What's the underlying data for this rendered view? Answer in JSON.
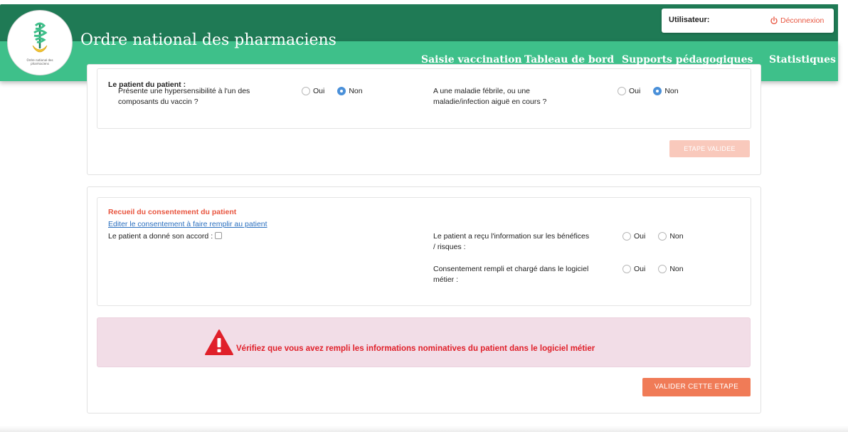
{
  "header": {
    "app_title": "Ordre national des pharmaciens",
    "logo_caption": "Ordre national des pharmaciens",
    "user_label": "Utilisateur:",
    "logout_label": "Déconnexion",
    "nav": [
      "Saisie vaccination",
      "Tableau de bord",
      "Supports pédagogiques",
      "Statistiques"
    ],
    "colors": {
      "dark": "#1f7a55",
      "light": "#3ec08a"
    }
  },
  "screening": {
    "partial_heading": "Le patient du patient :",
    "question_1": {
      "text_line1": "Présente une hypersensibilité à l'un des",
      "text_line2": "composants du vaccin ?",
      "options": [
        "Oui",
        "Non"
      ],
      "selected": "Non"
    },
    "question_2": {
      "text_line1": "A une maladie fébrile, ou une",
      "text_line2": "maladie/infection aiguë en cours ?",
      "options": [
        "Oui",
        "Non"
      ],
      "selected": "Non"
    },
    "button_label": "ETAPE VALIDEE"
  },
  "consent": {
    "title": "Recueil du consentement du patient",
    "edit_link": "Editer le consentement à faire remplir au patient",
    "agreement_label": "Le patient a donné son accord :",
    "question_info": {
      "text_line1": "Le patient a reçu l'information sur les bénéfices",
      "text_line2": "/ risques :",
      "options": [
        "Oui",
        "Non"
      ]
    },
    "question_software": {
      "text_line1": "Consentement rempli et chargé dans le logiciel",
      "text_line2": "métier :",
      "options": [
        "Oui",
        "Non"
      ]
    },
    "alert_text": "Vérifiez que vous avez rempli les informations nominatives du patient dans le logiciel métier",
    "validate_label": "VALIDER CETTE ETAPE"
  },
  "icons": [
    "caduceus-logo-icon",
    "power-icon",
    "warning-icon"
  ]
}
